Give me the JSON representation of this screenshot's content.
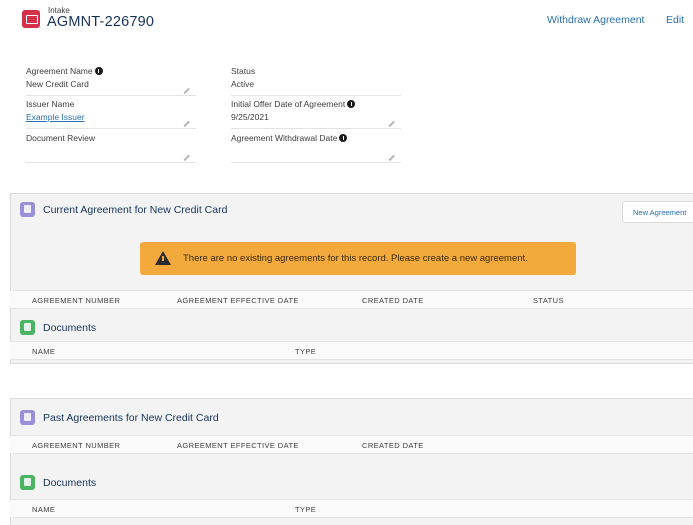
{
  "header": {
    "object_label": "Intake",
    "record_title": "AGMNT-226790",
    "withdraw_label": "Withdraw Agreement",
    "edit_label": "Edit"
  },
  "fields": [
    {
      "label": "Agreement Name",
      "value": "New Credit Card",
      "info": true,
      "link": false
    },
    {
      "label": "Status",
      "value": "Active",
      "info": false,
      "link": false
    },
    {
      "label": "Issuer Name",
      "value": "Example Issuer",
      "info": false,
      "link": true
    },
    {
      "label": "Initial Offer Date of Agreement",
      "value": "9/25/2021",
      "info": true,
      "link": false
    },
    {
      "label": "Document Review",
      "value": "",
      "info": false,
      "link": false
    },
    {
      "label": "Agreement Withdrawal Date",
      "value": "",
      "info": true,
      "link": false
    }
  ],
  "current": {
    "title": "Current Agreement for New Credit Card",
    "new_button": "New Agreement",
    "warning": "There are no existing agreements for this record. Please create a new agreement.",
    "columns": [
      "AGREEMENT NUMBER",
      "AGREEMENT EFFECTIVE DATE",
      "CREATED DATE",
      "STATUS"
    ],
    "documents_title": "Documents",
    "doc_columns": [
      "NAME",
      "TYPE"
    ]
  },
  "past": {
    "title": "Past Agreements for New Credit Card",
    "columns": [
      "AGREEMENT NUMBER",
      "AGREEMENT EFFECTIVE DATE",
      "CREATED DATE"
    ],
    "documents_title": "Documents",
    "doc_columns": [
      "NAME",
      "TYPE"
    ]
  },
  "colors": {
    "record_icon": "#d4304a",
    "link": "#2a6fb3",
    "warning_bg": "#f4a93d",
    "section_icon": "#9a8fd8",
    "documents_icon": "#4bb364"
  },
  "icons": {
    "record": "intake-record-icon",
    "info": "info-icon",
    "edit": "pencil-icon",
    "section": "agreement-icon",
    "documents": "document-icon",
    "warning": "warning-icon"
  }
}
